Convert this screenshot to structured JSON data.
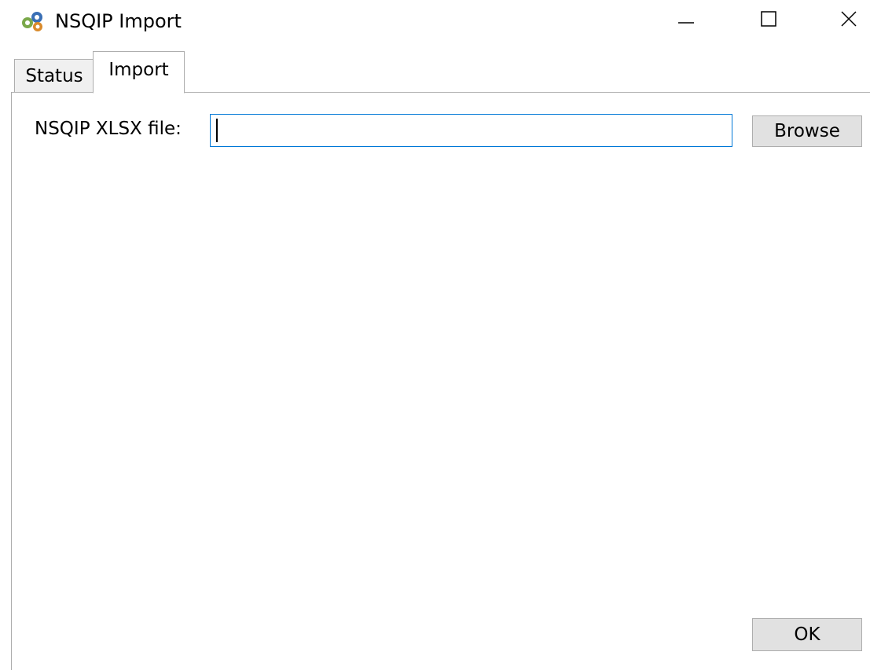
{
  "window": {
    "title": "NSQIP Import",
    "icon": "gears-app-icon",
    "controls": {
      "minimize": "minimize-icon",
      "maximize": "maximize-icon",
      "close": "close-icon"
    }
  },
  "tabs": [
    {
      "label": "Status",
      "selected": false
    },
    {
      "label": "Import",
      "selected": true
    }
  ],
  "import": {
    "file_label": "NSQIP XLSX file:",
    "file_value": "",
    "browse_label": "Browse",
    "ok_label": "OK"
  },
  "colors": {
    "focus_border": "#0078d7",
    "button_bg": "#e1e1e1",
    "border": "#adadad"
  }
}
